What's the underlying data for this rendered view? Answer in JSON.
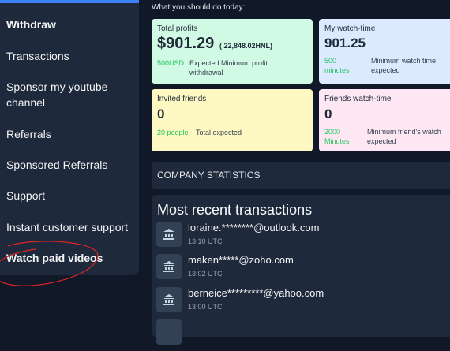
{
  "sidebar": {
    "items": [
      {
        "label": "Withdraw",
        "bold": true
      },
      {
        "label": "Transactions",
        "bold": false
      },
      {
        "label": "Sponsor my youtube channel",
        "bold": false
      },
      {
        "label": "Referrals",
        "bold": false
      },
      {
        "label": "Sponsored Referrals",
        "bold": false
      },
      {
        "label": "Support",
        "bold": false
      },
      {
        "label": "Instant customer support",
        "bold": false
      },
      {
        "label": "Watch paid videos",
        "bold": true
      }
    ],
    "sponsor_line1": "Sponsor my youtube",
    "sponsor_line2": "channel"
  },
  "main": {
    "header": "What you should do today:",
    "cards": {
      "total_profits": {
        "label": "Total profits",
        "value": "$901.29",
        "secondary": "( 22,848.02HNL)",
        "foot_value": "500USD",
        "foot_text": "Expected Minimum profit withdrawal",
        "foot_text_line1": "Expected Minimum profit",
        "foot_text_line2": "withdrawal"
      },
      "watch_time": {
        "label": "My watch-time",
        "value": "901.25",
        "foot_value_line1": "500",
        "foot_value_line2": "minutes",
        "foot_text_line1": "Minimum watch time",
        "foot_text_line2": "expected"
      },
      "invited_friends": {
        "label": "Invited friends",
        "value": "0",
        "foot_value": "20 people",
        "foot_text": "Total expected"
      },
      "friends_watch": {
        "label": "Friends watch-time",
        "value": "0",
        "foot_value_line1": "2000",
        "foot_value_line2": "Minutes",
        "foot_text_line1": "Minimum friend's watch",
        "foot_text_line2": "expected"
      }
    },
    "company_stats": "COMPANY STATISTICS",
    "transactions": {
      "title": "Most recent transactions",
      "rows": [
        {
          "email": "loraine.********@outlook.com",
          "time": "13:10 UTC"
        },
        {
          "email": "maken*****@zoho.com",
          "time": "13:02 UTC"
        },
        {
          "email": "berneice*********@yahoo.com",
          "time": "13:00 UTC"
        }
      ]
    }
  },
  "colors": {
    "background": "#111827",
    "panel": "#1e293b",
    "accent": "#3b82f6",
    "positive": "#22c55e",
    "annotation": "#dc2626"
  },
  "icons": [
    "bank-icon"
  ]
}
